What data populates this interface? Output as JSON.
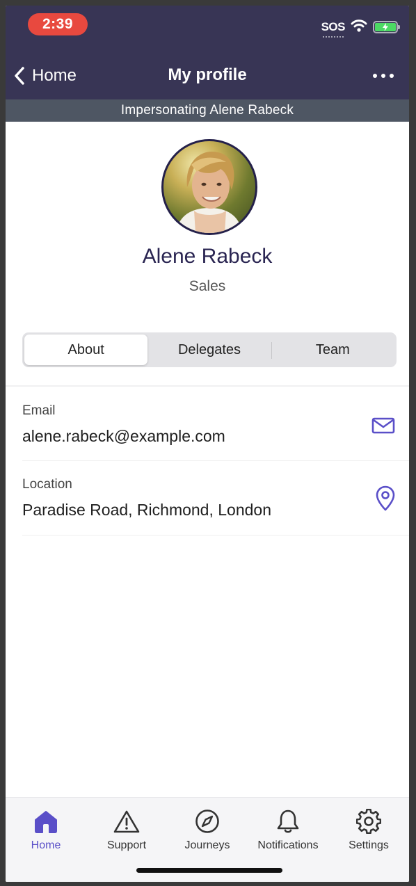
{
  "status": {
    "time": "2:39",
    "sos_text": "SOS"
  },
  "nav": {
    "back_label": "Home",
    "title": "My profile"
  },
  "banner": {
    "text": "Impersonating Alene Rabeck"
  },
  "profile": {
    "name": "Alene Rabeck",
    "department": "Sales"
  },
  "tabs": [
    {
      "label": "About",
      "selected": true
    },
    {
      "label": "Delegates",
      "selected": false
    },
    {
      "label": "Team",
      "selected": false
    }
  ],
  "details": [
    {
      "label": "Email",
      "value": "alene.rabeck@example.com",
      "icon": "mail-icon"
    },
    {
      "label": "Location",
      "value": "Paradise Road, Richmond, London",
      "icon": "location-pin-icon"
    }
  ],
  "tabbar": [
    {
      "label": "Home",
      "icon": "home-icon",
      "active": true
    },
    {
      "label": "Support",
      "icon": "warning-icon",
      "active": false
    },
    {
      "label": "Journeys",
      "icon": "compass-icon",
      "active": false
    },
    {
      "label": "Notifications",
      "icon": "bell-icon",
      "active": false
    },
    {
      "label": "Settings",
      "icon": "gear-icon",
      "active": false
    }
  ],
  "colors": {
    "header_bg": "#383555",
    "banner_bg": "#4e5663",
    "accent": "#5a4fc8",
    "time_pill": "#e8493f",
    "name_text": "#2a2552"
  }
}
